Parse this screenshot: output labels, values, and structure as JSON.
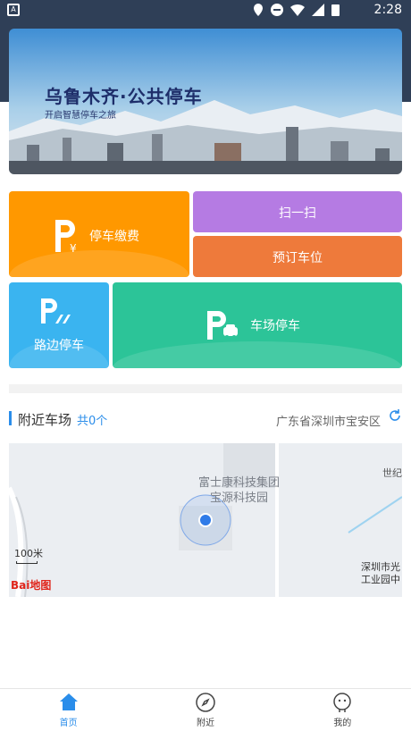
{
  "status_bar": {
    "time": "2:28"
  },
  "banner": {
    "title": "乌鲁木齐·公共停车",
    "subtitle": "开启智慧停车之旅"
  },
  "tiles": {
    "pay": "停车缴费",
    "scan": "扫一扫",
    "reserve": "预订车位",
    "roadside": "路边停车",
    "lot": "车场停车"
  },
  "nearby": {
    "title": "附近车场",
    "count": "共0个",
    "location": "广东省深圳市宝安区"
  },
  "map": {
    "poi_line1": "富士康科技集团",
    "poi_line2": "宝源科技园",
    "scale": "100米",
    "logo": "Bai地图",
    "label_right1": "深圳市光",
    "label_right2": "工业园中",
    "label_top_right": "世纪"
  },
  "tabbar": {
    "home": "首页",
    "nearby": "附近",
    "mine": "我的"
  },
  "colors": {
    "accent": "#2a8dea",
    "pay": "#ff9800",
    "scan": "#b57be3",
    "reserve": "#ee7a3b",
    "roadside": "#3ab4f0",
    "lot": "#2cc498"
  }
}
